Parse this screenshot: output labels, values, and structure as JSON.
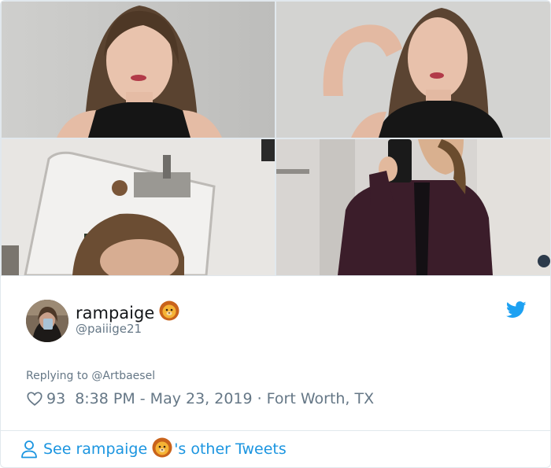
{
  "user": {
    "display_name": "rampaige",
    "name_emoji": "lion-face-emoji",
    "handle": "@paiiige21"
  },
  "reply": {
    "prefix": "Replying to ",
    "mention": "@Artbaesel"
  },
  "stats": {
    "likes": "93",
    "time": "8:38 PM - May 23, 2019",
    "separator": "·",
    "location": "Fort Worth, TX"
  },
  "footer": {
    "see_prefix": "See rampaige",
    "see_suffix": "'s other Tweets"
  },
  "icons": {
    "bird": "twitter-bird-icon",
    "heart": "heart-icon",
    "person": "person-icon"
  },
  "colors": {
    "twitter_blue": "#1b95e0",
    "secondary_text": "#657786",
    "border": "#e1e8ed"
  }
}
